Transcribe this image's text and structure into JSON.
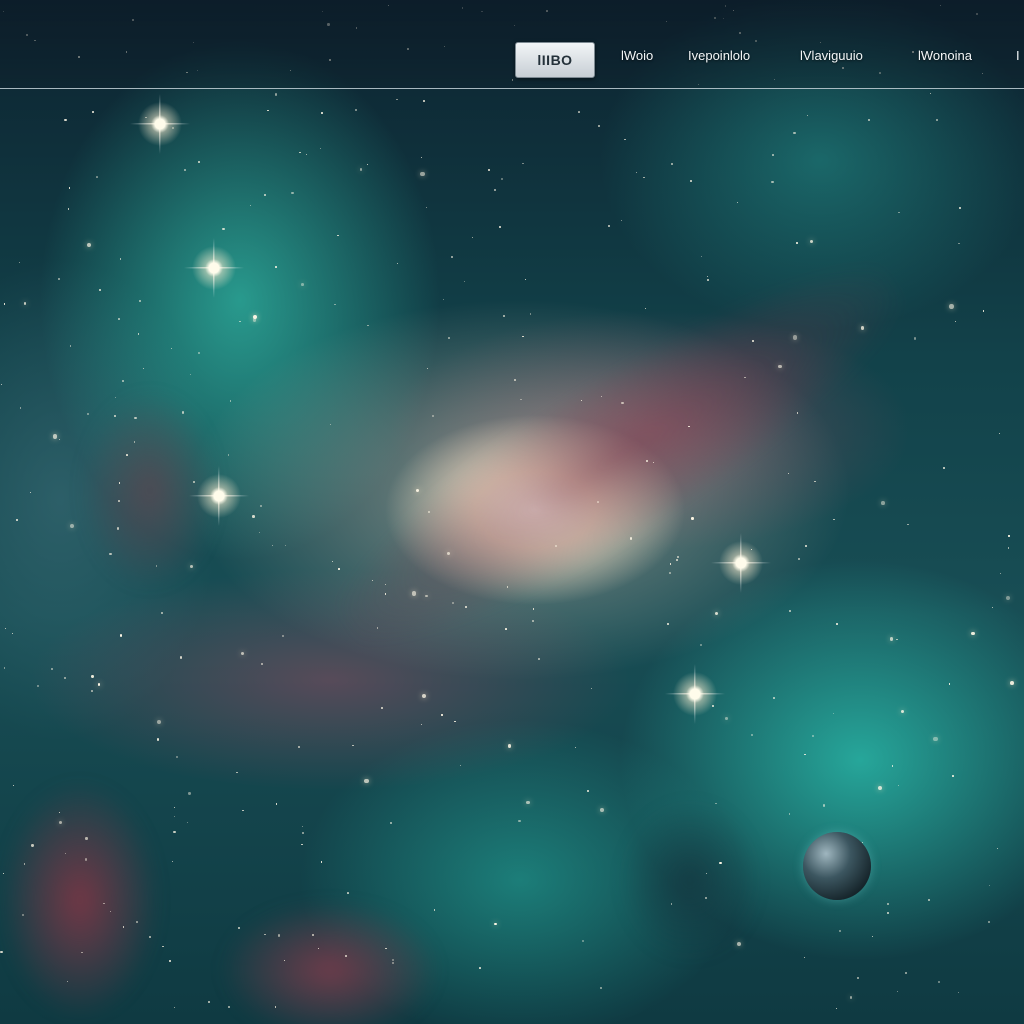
{
  "navbar": {
    "logo_label": "lIIBO",
    "links": [
      "lWoio",
      "Ivepoinlolo",
      "lVlaviguuio",
      "lWonoina"
    ],
    "edge_link_fragment": "I"
  },
  "colors": {
    "nebula_teal": "#3ce6c8",
    "galaxy_core": "#fffaeb",
    "dust_lane": "#7d374b",
    "background": "#0d2330"
  },
  "icons": [
    "planet-icon"
  ]
}
